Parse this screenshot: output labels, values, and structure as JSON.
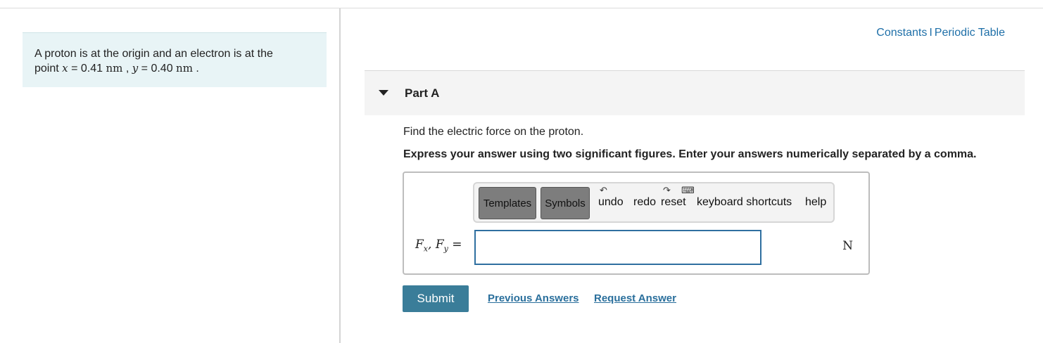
{
  "problem": {
    "line1": "A proton is at the origin and an electron is at the",
    "point_word": "point",
    "x_var": "x",
    "eq1": "= 0.41",
    "unit1": "nm",
    "sep": ",",
    "y_var": "y",
    "eq2": "= 0.40",
    "unit2": "nm",
    "end": "."
  },
  "links": {
    "constants": "Constants",
    "separator": "I",
    "periodic_table": "Periodic Table"
  },
  "part": {
    "title": "Part A",
    "question": "Find the electric force on the proton.",
    "instruction": "Express your answer using two significant figures. Enter your answers numerically separated by a comma."
  },
  "toolbar": {
    "templates": "Templates",
    "symbols": "Symbols",
    "undo": "undo",
    "redo": "redo",
    "reset": "reset",
    "keyboard_shortcuts": "keyboard shortcuts",
    "help": "help"
  },
  "answer": {
    "F": "F",
    "sub_x": "x",
    "comma": ",",
    "sub_y": "y",
    "equals": "=",
    "value": "",
    "unit": "N"
  },
  "actions": {
    "submit": "Submit",
    "previous_answers": "Previous Answers",
    "request_answer": "Request Answer"
  }
}
